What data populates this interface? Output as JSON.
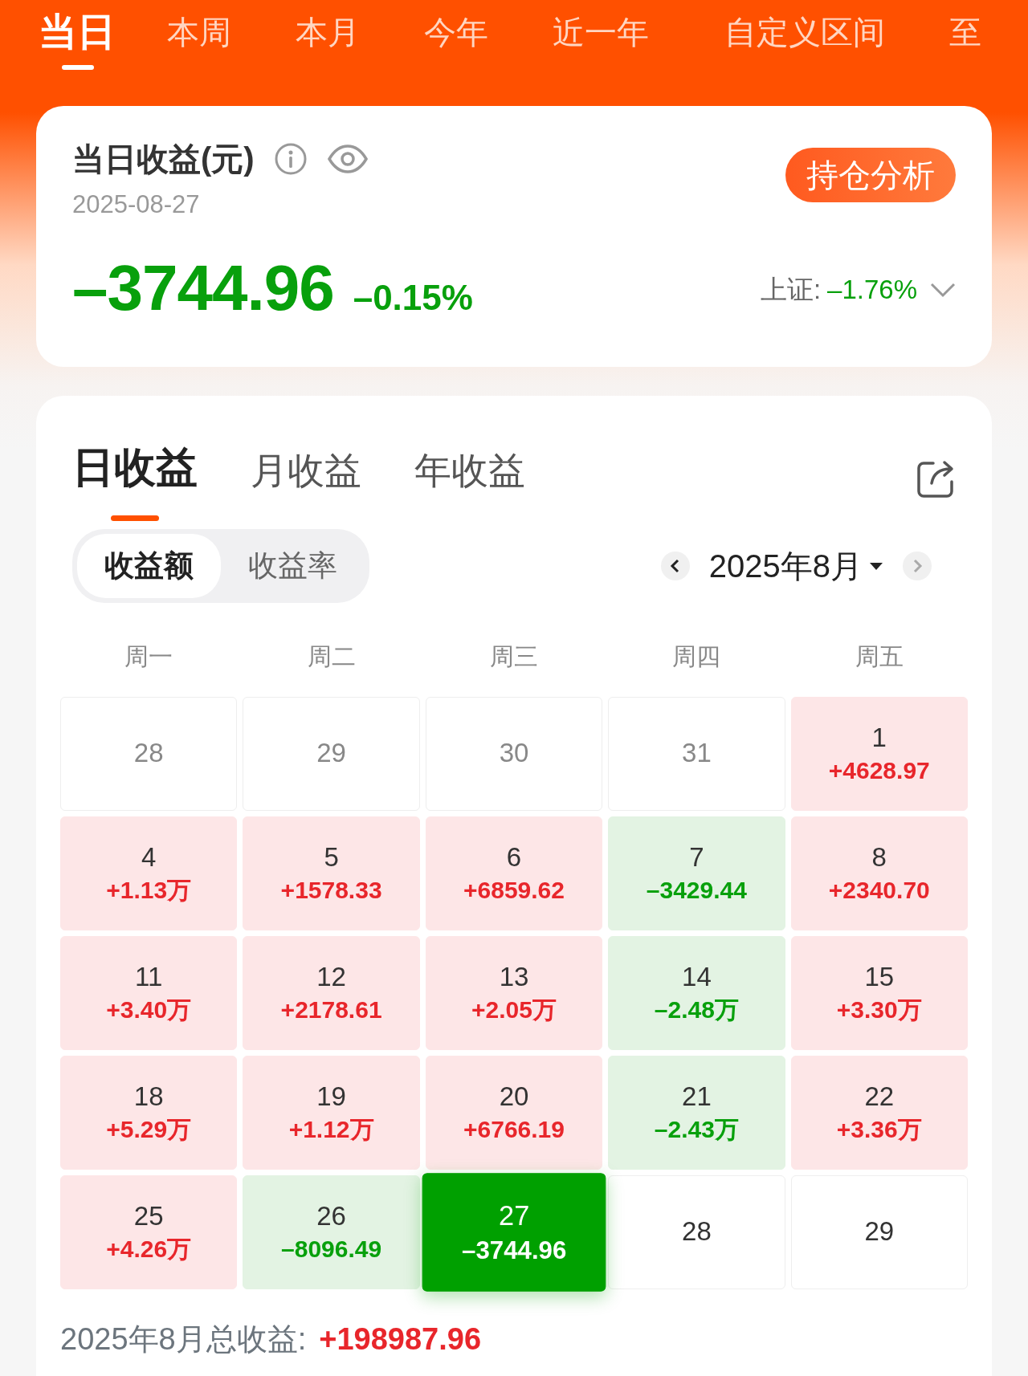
{
  "period_tabs": [
    {
      "label": "当日",
      "selected": true
    },
    {
      "label": "本周",
      "selected": false
    },
    {
      "label": "本月",
      "selected": false
    },
    {
      "label": "今年",
      "selected": false
    },
    {
      "label": "近一年",
      "selected": false
    },
    {
      "label": "自定义区间",
      "selected": false
    },
    {
      "label": "至",
      "selected": false
    }
  ],
  "summary": {
    "title": "当日收益(元)",
    "date": "2025-08-27",
    "amount": "–3744.96",
    "percent": "–0.15%",
    "index_label": "上证:",
    "index_value": "–1.76%",
    "button": "持仓分析"
  },
  "earnings_tabs": [
    {
      "label": "日收益",
      "selected": true
    },
    {
      "label": "月收益",
      "selected": false
    },
    {
      "label": "年收益",
      "selected": false
    }
  ],
  "metric_toggle": [
    {
      "label": "收益额",
      "selected": true
    },
    {
      "label": "收益率",
      "selected": false
    }
  ],
  "month_picker": {
    "label": "2025年8月"
  },
  "weekdays": [
    "周一",
    "周二",
    "周三",
    "周四",
    "周五"
  ],
  "days": [
    {
      "day": "28",
      "kind": "other",
      "selected": false
    },
    {
      "day": "29",
      "kind": "other",
      "selected": false
    },
    {
      "day": "30",
      "kind": "other",
      "selected": false
    },
    {
      "day": "31",
      "kind": "other",
      "selected": false
    },
    {
      "day": "1",
      "value": "+4628.97",
      "kind": "gain",
      "selected": false
    },
    {
      "day": "4",
      "value": "+1.13万",
      "kind": "gain",
      "selected": false
    },
    {
      "day": "5",
      "value": "+1578.33",
      "kind": "gain",
      "selected": false
    },
    {
      "day": "6",
      "value": "+6859.62",
      "kind": "gain",
      "selected": false
    },
    {
      "day": "7",
      "value": "–3429.44",
      "kind": "loss",
      "selected": false
    },
    {
      "day": "8",
      "value": "+2340.70",
      "kind": "gain",
      "selected": false
    },
    {
      "day": "11",
      "value": "+3.40万",
      "kind": "gain",
      "selected": false
    },
    {
      "day": "12",
      "value": "+2178.61",
      "kind": "gain",
      "selected": false
    },
    {
      "day": "13",
      "value": "+2.05万",
      "kind": "gain",
      "selected": false
    },
    {
      "day": "14",
      "value": "–2.48万",
      "kind": "loss",
      "selected": false
    },
    {
      "day": "15",
      "value": "+3.30万",
      "kind": "gain",
      "selected": false
    },
    {
      "day": "18",
      "value": "+5.29万",
      "kind": "gain",
      "selected": false
    },
    {
      "day": "19",
      "value": "+1.12万",
      "kind": "gain",
      "selected": false
    },
    {
      "day": "20",
      "value": "+6766.19",
      "kind": "gain",
      "selected": false
    },
    {
      "day": "21",
      "value": "–2.43万",
      "kind": "loss",
      "selected": false
    },
    {
      "day": "22",
      "value": "+3.36万",
      "kind": "gain",
      "selected": false
    },
    {
      "day": "25",
      "value": "+4.26万",
      "kind": "gain",
      "selected": false
    },
    {
      "day": "26",
      "value": "–8096.49",
      "kind": "loss",
      "selected": false
    },
    {
      "day": "27",
      "value": "–3744.96",
      "kind": "loss",
      "selected": true
    },
    {
      "day": "28",
      "kind": "future",
      "selected": false
    },
    {
      "day": "29",
      "kind": "future",
      "selected": false
    }
  ],
  "total": {
    "label": "2025年8月总收益:",
    "value": "+198987.96"
  }
}
